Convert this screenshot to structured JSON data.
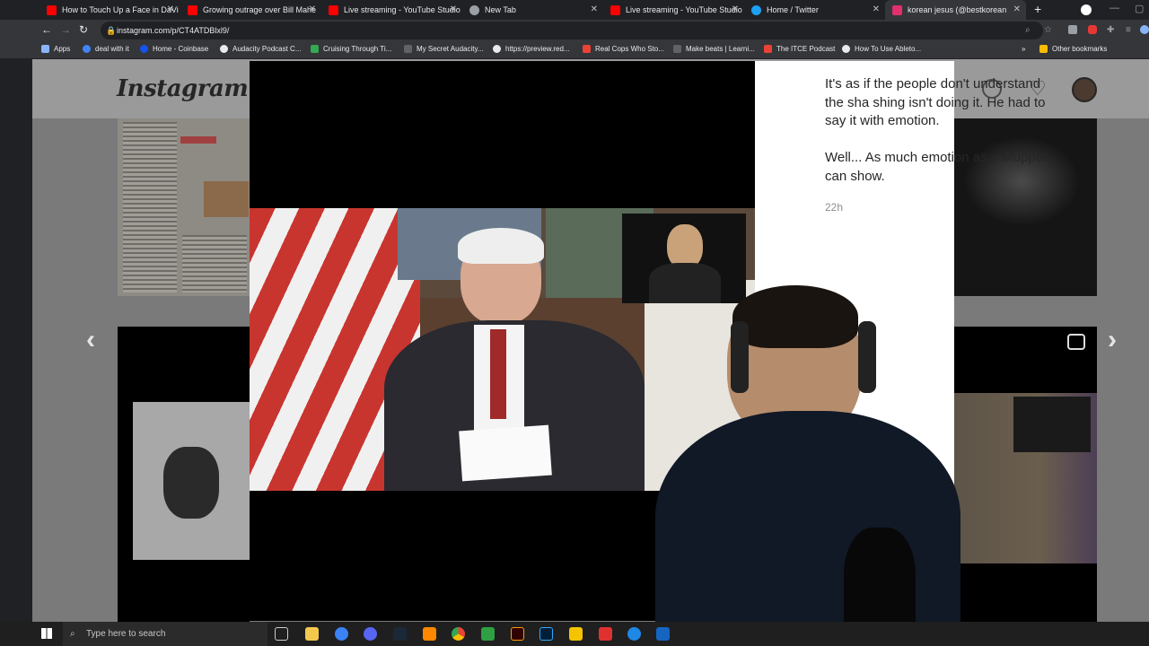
{
  "tabs": [
    {
      "title": "How to Touch Up a Face in DaVi",
      "favicon_color": "#ff0000"
    },
    {
      "title": "Growing outrage over Bill Mahe",
      "favicon_color": "#ff0000"
    },
    {
      "title": "Live streaming - YouTube Studio",
      "favicon_color": "#ff0000"
    },
    {
      "title": "New Tab",
      "favicon_color": "#9aa0a6"
    },
    {
      "title": "Live streaming - YouTube Studio",
      "favicon_color": "#ff0000"
    },
    {
      "title": "Home / Twitter",
      "favicon_color": "#1da1f2"
    },
    {
      "title": "korean jesus (@bestkorean",
      "favicon_color": "#e1306c"
    }
  ],
  "address": {
    "url": "instagram.com/p/CT4ATDBlxl9/"
  },
  "bookmarks": [
    {
      "label": "Apps",
      "color": "#8ab4f8"
    },
    {
      "label": "deal with it",
      "color": "#4285f4"
    },
    {
      "label": "Home - Coinbase",
      "color": "#1652f0"
    },
    {
      "label": "Audacity Podcast C...",
      "color": "#e8eaed"
    },
    {
      "label": "Cruising Through Ti...",
      "color": "#34a853"
    },
    {
      "label": "My Secret Audacity...",
      "color": "#9aa0a6"
    },
    {
      "label": "https://preview.red...",
      "color": "#e8eaed"
    },
    {
      "label": "Real Cops Who Sto...",
      "color": "#ea4335"
    },
    {
      "label": "Make beats | Learni...",
      "color": "#9aa0a6"
    },
    {
      "label": "The ITCE Podcast",
      "color": "#ea4335"
    },
    {
      "label": "How To Use Ableto...",
      "color": "#e8eaed"
    }
  ],
  "bookmarks_extra": {
    "more": "»",
    "other": "Other bookmarks"
  },
  "instagram": {
    "logo": "Instagram",
    "comment_lines": [
      "It's as if the people don't understand",
      "the sha shing isn't doing it. He had to",
      "say it with emotion."
    ],
    "comment_lines2": [
      "Well... As much emotion as a Muppet",
      "can show."
    ],
    "time": "22h"
  },
  "taskbar": {
    "search_placeholder": "Type here to search"
  },
  "icons": {
    "back": "back-arrow-icon",
    "forward": "forward-arrow-icon",
    "reload": "reload-icon",
    "prev": "chevron-left-icon",
    "next": "chevron-right-icon",
    "windows": "windows-start-icon"
  }
}
